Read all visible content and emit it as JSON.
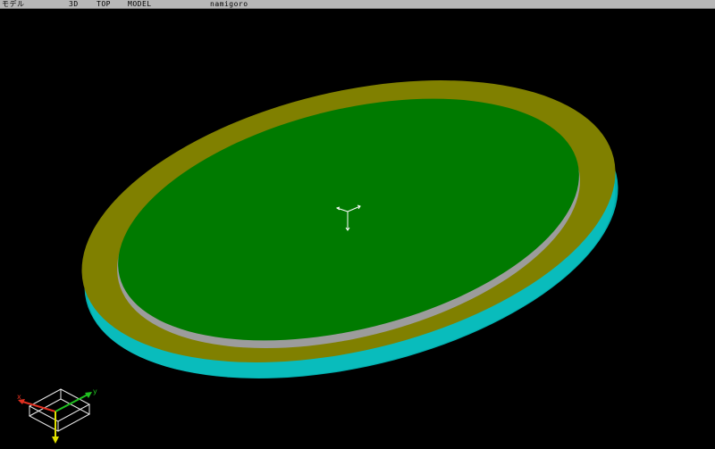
{
  "titlebar": {
    "window_label": "モデル",
    "view_mode": "3D",
    "view_direction": "TOP",
    "space": "MODEL",
    "model_name": "namigoro"
  },
  "viewport": {
    "background": "#000000",
    "colors": {
      "inner_surface": "#007a00",
      "rim_top": "#808000",
      "rim_side": "#00b3b3",
      "inner_wall": "#9a9a9a"
    },
    "axis_gizmo": {
      "x_label": "x",
      "y_label": "y",
      "x_color": "#e03020",
      "y_color": "#20c020",
      "z_color": "#e0e000"
    }
  }
}
